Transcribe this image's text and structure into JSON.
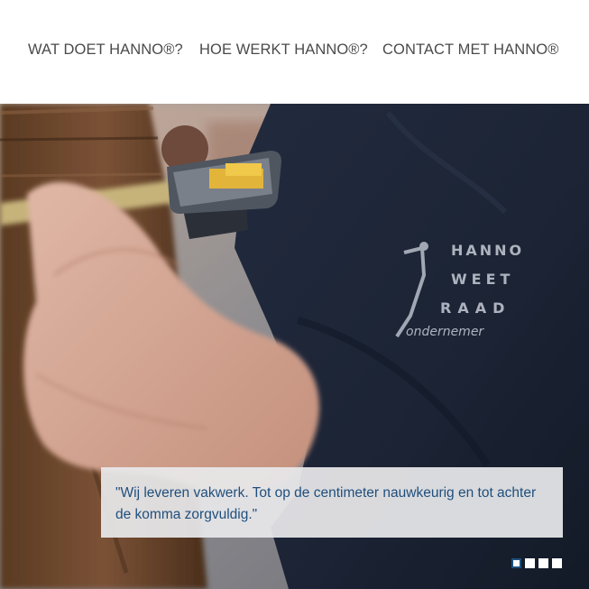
{
  "nav": {
    "items": [
      {
        "label": "WAT DOET HANNO®?"
      },
      {
        "label": "HOE WERKT HANNO®?"
      },
      {
        "label": "CONTACT MET HANNO®"
      }
    ]
  },
  "hero": {
    "logo": {
      "lines": [
        "HANNO",
        "WEET",
        "RAAD",
        "ondernemer"
      ]
    },
    "caption": "\"Wij leveren vakwerk. Tot op de centimeter nauwkeurig en tot achter de komma zorgvuldig.\"",
    "slider": {
      "count": 4,
      "active_index": 0
    }
  },
  "colors": {
    "nav_text": "#4a4a4a",
    "caption_text": "#1f4f7d",
    "caption_bg": "#e8e8eb",
    "jacket": "#1b2334"
  }
}
